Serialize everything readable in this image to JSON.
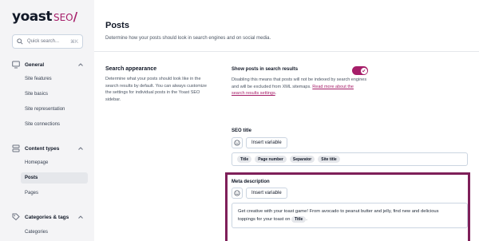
{
  "brand": {
    "name": "yoast",
    "suffix": "SEO",
    "slash": "/"
  },
  "search": {
    "placeholder": "Quick search...",
    "shortcut": "⌘K"
  },
  "sidebar": {
    "sections": [
      {
        "label": "General",
        "icon": "desktop-icon",
        "expanded": true,
        "items": [
          "Site features",
          "Site basics",
          "Site representation",
          "Site connections"
        ]
      },
      {
        "label": "Content types",
        "icon": "stack-icon",
        "expanded": true,
        "items": [
          "Homepage",
          "Posts",
          "Pages"
        ],
        "active": "Posts"
      },
      {
        "label": "Categories & tags",
        "icon": "tag-icon",
        "expanded": true,
        "items": [
          "Categories"
        ]
      }
    ]
  },
  "page": {
    "title": "Posts",
    "description": "Determine how your posts should look in search engines and on social media."
  },
  "search_appearance": {
    "title": "Search appearance",
    "description": "Determine what your posts should look like in the search results by default. You can always customize the settings for individual posts in the Yoast SEO sidebar."
  },
  "show_in_results": {
    "label": "Show posts in search results",
    "enabled": true,
    "description": "Disabling this means that posts will not be indexed by search engines and will be excluded from XML sitemaps.",
    "link_text": "Read more about the search results settings",
    "link_suffix": "."
  },
  "seo_title": {
    "label": "SEO title",
    "insert_label": "Insert variable",
    "variables": [
      "Title",
      "Page number",
      "Separator",
      "Site title"
    ]
  },
  "meta_description": {
    "label": "Meta description",
    "insert_label": "Insert variable",
    "text_line1": "Get creative with your toast game! From avocado to peanut butter and jelly, find new and delicious",
    "text_line2": "toppings for your toast on",
    "variable": "Title",
    "text_end": "."
  },
  "colors": {
    "accent": "#a61e69",
    "highlight_border": "#7e1f59"
  }
}
